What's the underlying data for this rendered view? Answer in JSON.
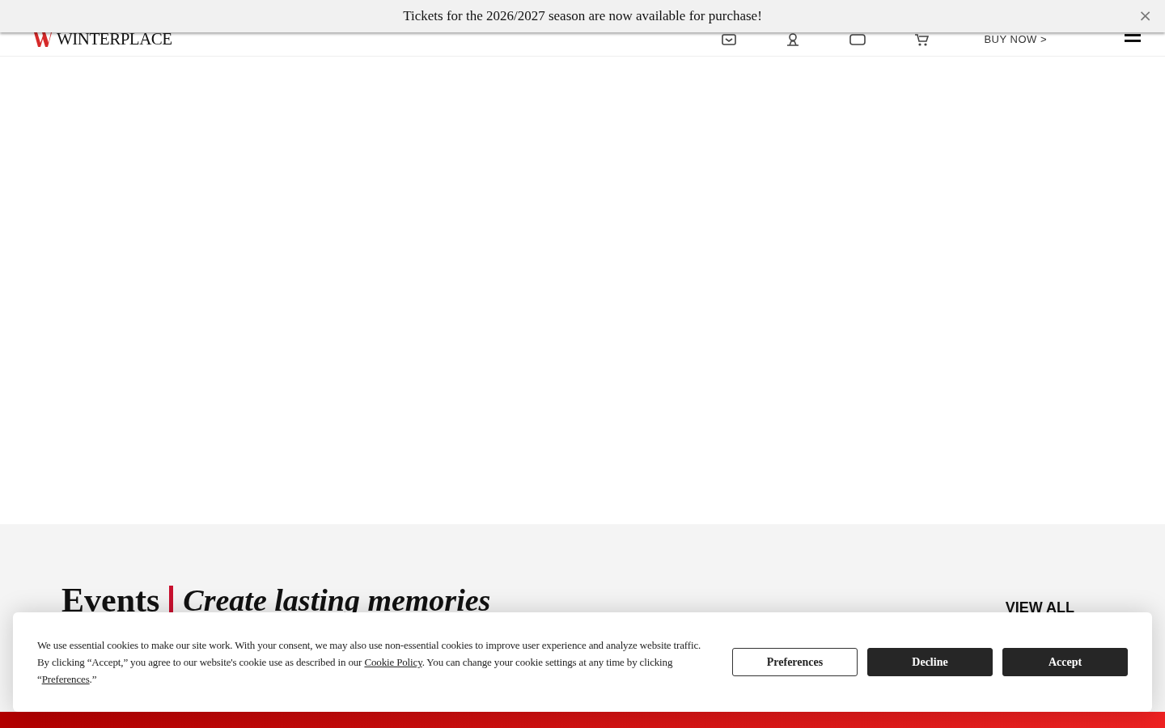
{
  "announcement": {
    "text": "Tickets for the 2026/2027 season are now available for purchase!",
    "close": "×"
  },
  "header": {
    "logo": "WINTERPLACE",
    "buy_now": "BUY NOW >"
  },
  "events": {
    "title": "Events",
    "subtitle": "Create lasting memories",
    "view_all": "VIEW ALL"
  },
  "cookie_banner": {
    "text": "We use essential cookies to make our site work. With your consent, we may also use non-essential cookies to improve user experience and analyze website traffic. By clicking “Accept,” you agree to our website's cookie use as described in our ",
    "policy_link": "Cookie Policy",
    "text_2": ". You can change your cookie settings at any time by clicking “",
    "preferences_link": "Preferences",
    "text_3": ".”",
    "buttons": [
      {
        "label": "Preferences",
        "kind": "outline"
      },
      {
        "label": "Decline",
        "kind": "solid"
      },
      {
        "label": "Accept",
        "kind": "solid"
      }
    ]
  }
}
